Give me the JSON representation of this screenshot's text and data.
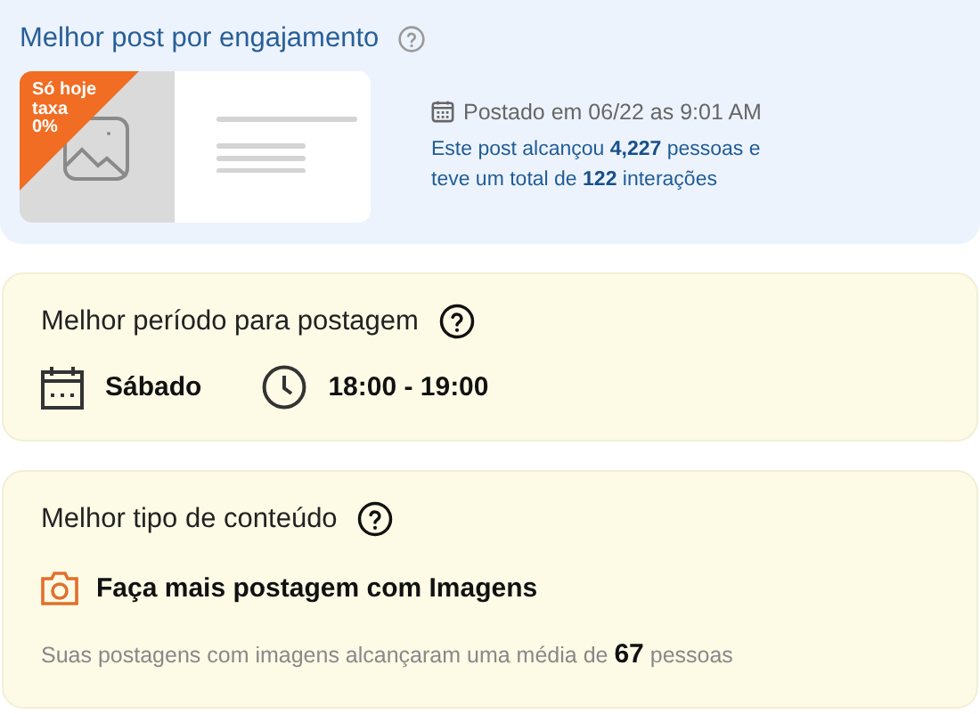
{
  "best_post": {
    "title": "Melhor post por engajamento",
    "badge_lines": [
      "Só hoje",
      "taxa",
      "0%"
    ],
    "posted": "Postado em 06/22 as 9:01 AM",
    "summary": "Este post alcançou **4,227** pessoas e teve um total de **122** interações"
  },
  "best_period": {
    "title": "Melhor período para postagem",
    "day": "Sábado",
    "time": "18:00 - 19:00"
  },
  "best_content": {
    "title": "Melhor tipo de conteúdo",
    "tip": "Faça mais postagem com Imagens",
    "summary": "Suas postagens com imagens alcançaram uma média de **67** pessoas"
  }
}
